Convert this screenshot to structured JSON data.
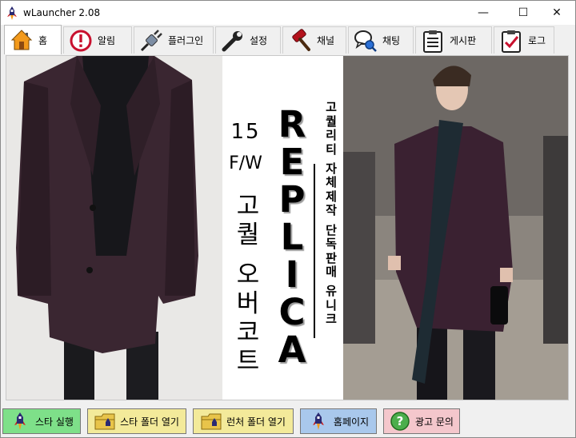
{
  "window": {
    "title": "wLauncher 2.08",
    "minimize_glyph": "—",
    "maximize_glyph": "☐",
    "close_glyph": "✕"
  },
  "tabs": [
    {
      "label": "홈",
      "icon": "home-icon",
      "active": true
    },
    {
      "label": "알림",
      "icon": "alert-icon",
      "active": false
    },
    {
      "label": "플러그인",
      "icon": "plugin-icon",
      "active": false
    },
    {
      "label": "설정",
      "icon": "wrench-icon",
      "active": false
    },
    {
      "label": "채널",
      "icon": "hammer-icon",
      "active": false
    },
    {
      "label": "채팅",
      "icon": "chat-search-icon",
      "active": false
    },
    {
      "label": "게시판",
      "icon": "clipboard-icon",
      "active": false
    },
    {
      "label": "로그",
      "icon": "checklist-icon",
      "active": false
    }
  ],
  "banner": {
    "season_line1": "15",
    "season_line2": "F/W",
    "product_text": "고퀄 오버코트",
    "replica_text": "REPLICA",
    "tagline": "고퀄리티 자체제작 단독판매 유니크"
  },
  "bottom_buttons": [
    {
      "label": "스타 실행",
      "icon": "rocket-icon",
      "bg": "#7ee089"
    },
    {
      "label": "스타 폴더 열기",
      "icon": "folder-rocket-icon",
      "bg": "#f3ea9a"
    },
    {
      "label": "런처 폴더 열기",
      "icon": "folder-rocket-icon",
      "bg": "#f3ea9a"
    },
    {
      "label": "홈페이지",
      "icon": "rocket-icon",
      "bg": "#a9c8ec"
    },
    {
      "label": "광고 문의",
      "icon": "help-icon",
      "bg": "#f4c7cc"
    }
  ],
  "colors": {
    "accent_red": "#c8102e",
    "home_orange": "#f39a1c"
  }
}
